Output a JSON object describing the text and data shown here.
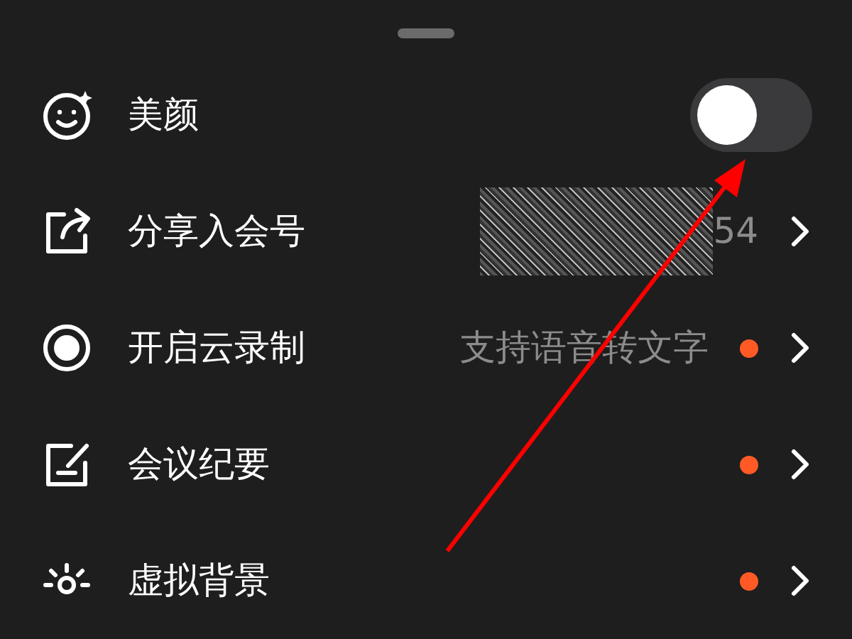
{
  "items": [
    {
      "kind": "toggle",
      "label": "美颜",
      "on": false
    },
    {
      "kind": "masked",
      "label": "分享入会号",
      "value": "54"
    },
    {
      "kind": "link",
      "label": "开启云录制",
      "value": "支持语音转文字",
      "dot": true
    },
    {
      "kind": "link",
      "label": "会议纪要",
      "dot": true
    },
    {
      "kind": "link",
      "label": "虚拟背景",
      "dot": true
    }
  ]
}
